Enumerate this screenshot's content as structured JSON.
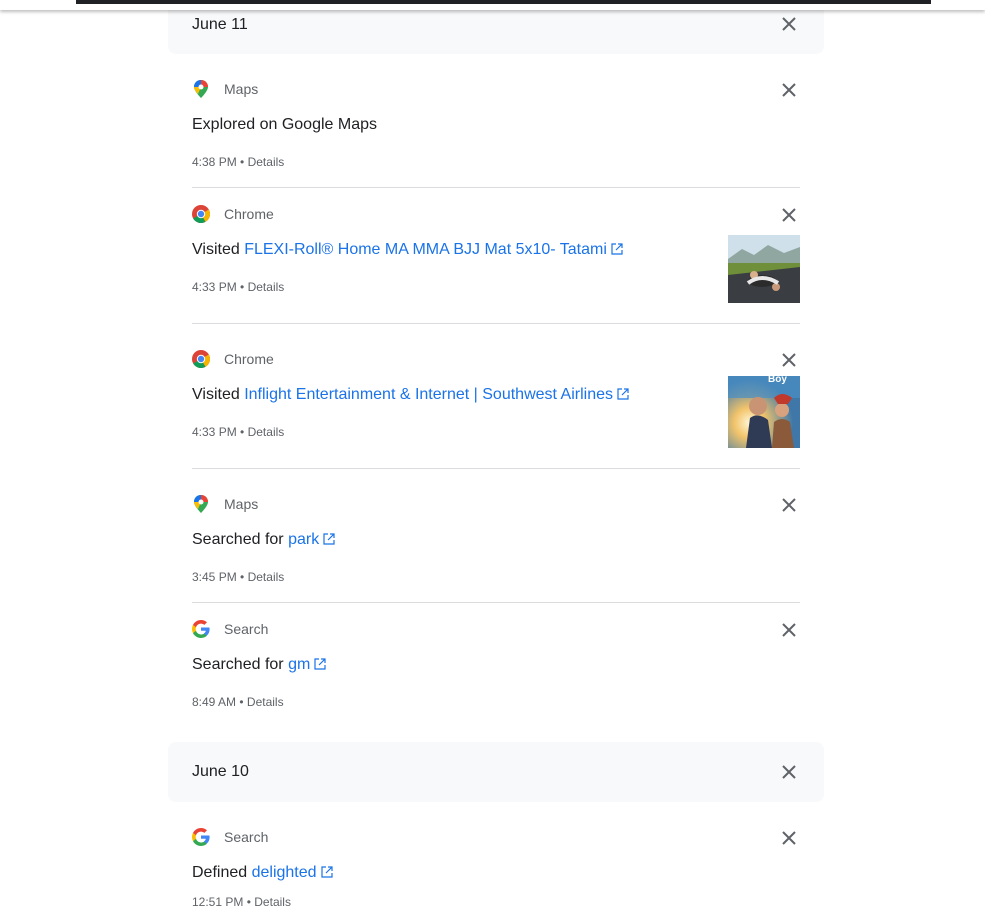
{
  "days": [
    {
      "date": "June 11",
      "items": [
        {
          "product": "Maps",
          "icon": "maps-pin-icon",
          "prefix": "Explored on Google Maps",
          "link": "",
          "time": "4:38 PM",
          "details": "Details"
        },
        {
          "product": "Chrome",
          "icon": "chrome-icon",
          "prefix": "Visited ",
          "link": "FLEXI-Roll® Home MA MMA BJJ Mat 5x10- Tatami",
          "time": "4:33 PM",
          "details": "Details",
          "thumbnail": "grappling-mat-photo"
        },
        {
          "product": "Chrome",
          "icon": "chrome-icon",
          "prefix": "Visited ",
          "link": "Inflight Entertainment & Internet | Southwest Airlines",
          "time": "4:33 PM",
          "details": "Details",
          "thumbnail": "movie-poster-photo",
          "thumbnail_text": "Boy"
        },
        {
          "product": "Maps",
          "icon": "maps-pin-icon",
          "prefix": "Searched for ",
          "link": "park",
          "time": "3:45 PM",
          "details": "Details"
        },
        {
          "product": "Search",
          "icon": "google-g-icon",
          "prefix": "Searched for ",
          "link": "gm",
          "time": "8:49 AM",
          "details": "Details"
        }
      ]
    },
    {
      "date": "June 10",
      "items": [
        {
          "product": "Search",
          "icon": "google-g-icon",
          "prefix": "Defined ",
          "link": "delighted",
          "time": "12:51 PM",
          "details": "Details"
        }
      ]
    }
  ],
  "separator": "•",
  "colors": {
    "link": "#1a73e8",
    "secondary_text": "#5f6368",
    "divider": "#dadce0",
    "header_bg": "#f8f9fa"
  }
}
